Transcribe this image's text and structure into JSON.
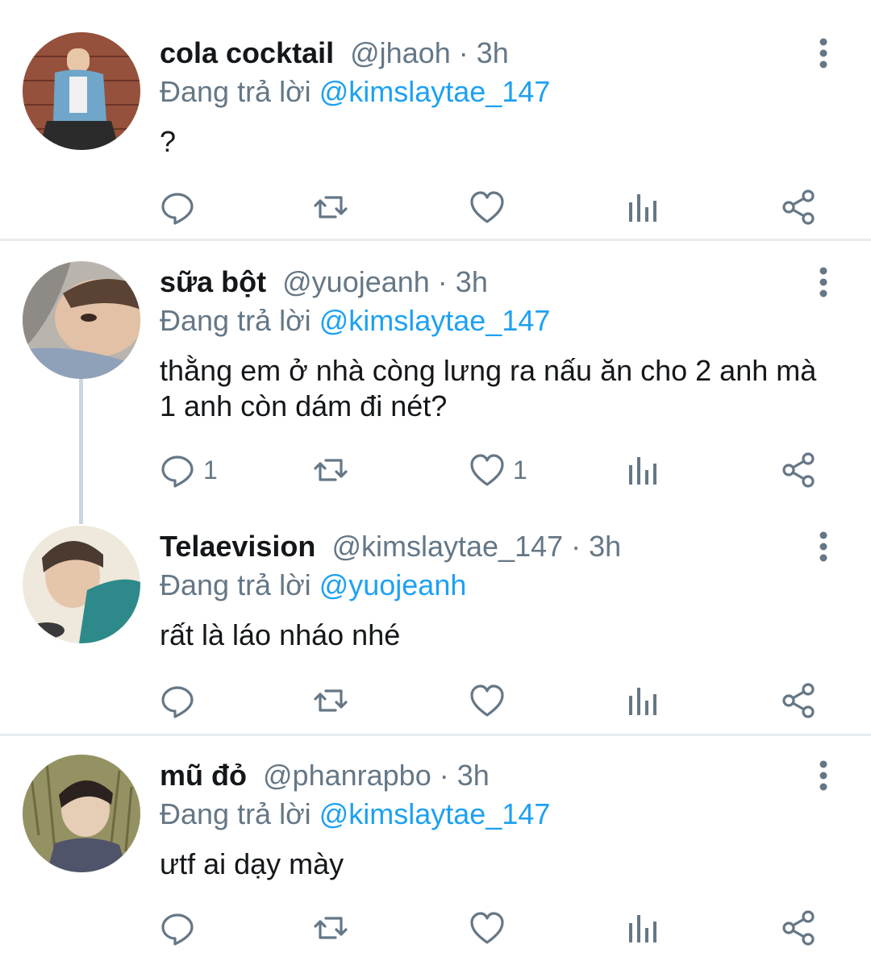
{
  "reply_prefix": "Đang trả lời",
  "tweets": [
    {
      "name": "cola cocktail",
      "handle": "@jhaoh",
      "time": "3h",
      "reply_to": "@kimslaytae_147",
      "text": "?",
      "replies": "",
      "likes": ""
    },
    {
      "name": "sữa bột",
      "handle": "@yuojeanh",
      "time": "3h",
      "reply_to": "@kimslaytae_147",
      "text": "thằng em ở nhà còng lưng ra nấu ăn cho 2 anh mà 1 anh còn dám đi nét?",
      "replies": "1",
      "likes": "1"
    },
    {
      "name": "Telaevision",
      "handle": "@kimslaytae_147",
      "time": "3h",
      "reply_to": "@yuojeanh",
      "text": "rất là láo nháo nhé",
      "replies": "",
      "likes": ""
    },
    {
      "name": "mũ đỏ",
      "handle": "@phanrapbo",
      "time": "3h",
      "reply_to": "@kimslaytae_147",
      "text": "ưtf ai dạy mày",
      "replies": "",
      "likes": ""
    }
  ],
  "icons": {
    "reply": "reply-icon",
    "retweet": "retweet-icon",
    "like": "heart-icon",
    "views": "analytics-icon",
    "share": "share-icon",
    "more": "more-vertical-icon"
  },
  "colors": {
    "mention": "#1da1f2",
    "secondary_text": "#657786",
    "divider": "#e6ecf0"
  }
}
